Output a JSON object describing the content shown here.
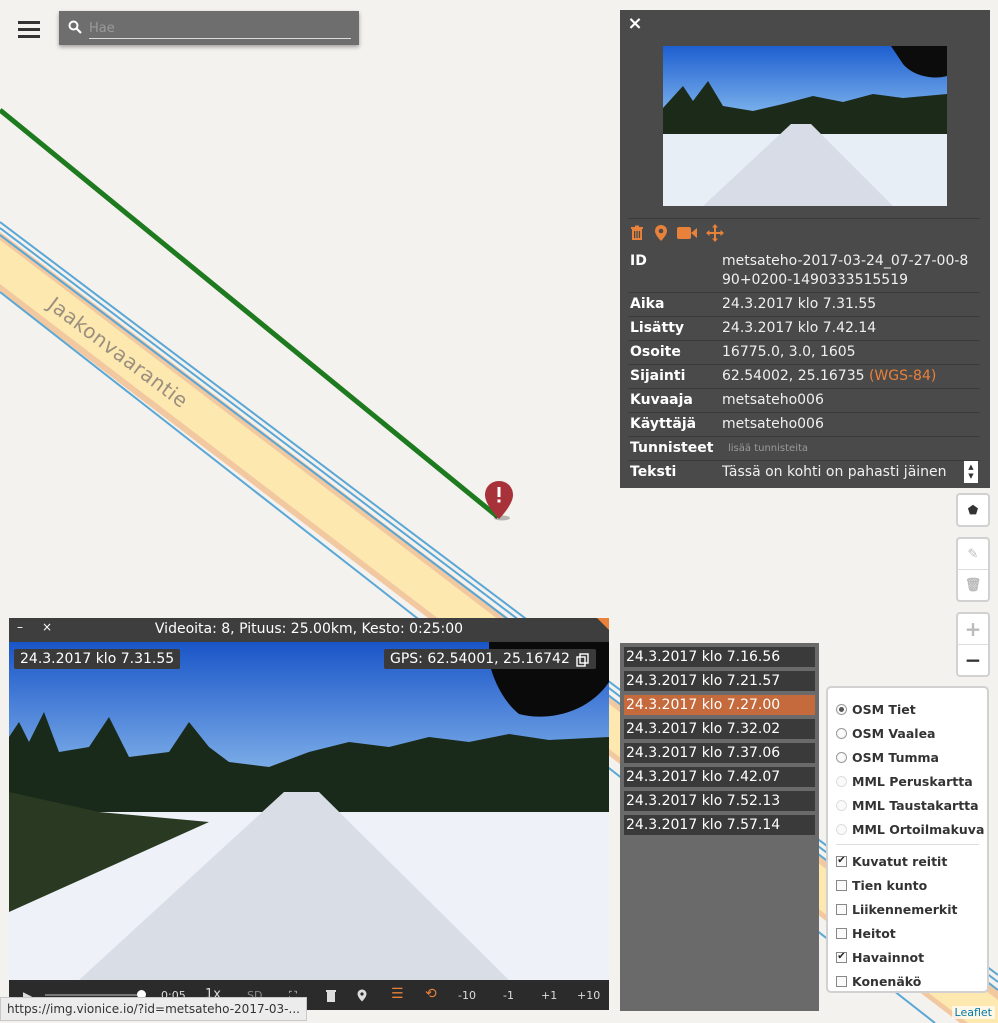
{
  "search": {
    "placeholder": "Hae"
  },
  "map": {
    "road_label": "Jaakonvaarantie"
  },
  "info": {
    "fields": [
      {
        "key": "ID",
        "value": "metsateho-2017-03-24_07-27-00-890+0200-1490333515519"
      },
      {
        "key": "Aika",
        "value": "24.3.2017 klo 7.31.55"
      },
      {
        "key": "Lisätty",
        "value": "24.3.2017 klo 7.42.14"
      },
      {
        "key": "Osoite",
        "value": "16775.0, 3.0, 1605"
      },
      {
        "key": "Sijainti",
        "value": "62.54002, 25.16735",
        "extra": "(WGS-84)"
      },
      {
        "key": "Kuvaaja",
        "value": "metsateho006"
      },
      {
        "key": "Käyttäjä",
        "value": "metsateho006"
      },
      {
        "key": "Tunnisteet",
        "value": "lisää tunnisteita"
      },
      {
        "key": "Teksti",
        "value": "Tässä on kohti on pahasti jäinen"
      }
    ],
    "tools": [
      "trash-icon",
      "map-pin-icon",
      "video-camera-icon",
      "move-icon"
    ]
  },
  "video": {
    "title": "Videoita: 8, Pituus: 25.00km, Kesto: 0:25:00",
    "minimize": "–",
    "close": "×",
    "timestamp": "24.3.2017 klo 7.31.55",
    "gps": "GPS: 62.54001, 25.16742",
    "controls": {
      "time": "0:05",
      "speed": "1x",
      "quality": "SD",
      "steps": [
        "-10",
        "-1",
        "+1",
        "+10"
      ]
    }
  },
  "time_list": [
    "24.3.2017 klo 7.16.56",
    "24.3.2017 klo 7.21.57",
    "24.3.2017 klo 7.27.00",
    "24.3.2017 klo 7.32.02",
    "24.3.2017 klo 7.37.06",
    "24.3.2017 klo 7.42.07",
    "24.3.2017 klo 7.52.13",
    "24.3.2017 klo 7.57.14"
  ],
  "time_list_active_index": 2,
  "layers": {
    "base": [
      {
        "label": "OSM Tiet",
        "selected": true,
        "enabled": true
      },
      {
        "label": "OSM Vaalea",
        "selected": false,
        "enabled": true
      },
      {
        "label": "OSM Tumma",
        "selected": false,
        "enabled": true
      },
      {
        "label": "MML Peruskartta",
        "selected": false,
        "enabled": false
      },
      {
        "label": "MML Taustakartta",
        "selected": false,
        "enabled": false
      },
      {
        "label": "MML Ortoilmakuva",
        "selected": false,
        "enabled": false
      }
    ],
    "overlays": [
      {
        "label": "Kuvatut reitit",
        "checked": true
      },
      {
        "label": "Tien kunto",
        "checked": false
      },
      {
        "label": "Liikennemerkit",
        "checked": false
      },
      {
        "label": "Heitot",
        "checked": false
      },
      {
        "label": "Havainnot",
        "checked": true
      },
      {
        "label": "Konenäkö",
        "checked": false
      }
    ]
  },
  "zoom": {
    "in": "+",
    "out": "−"
  },
  "status_url": "https://img.vionice.io/?id=metsateho-2017-03-...",
  "attribution": "Leaflet",
  "colors": {
    "accent": "#e8813a",
    "panel": "#4a4a4a",
    "route_green": "#1e7a1e",
    "route_blue": "#5aa7d6"
  }
}
